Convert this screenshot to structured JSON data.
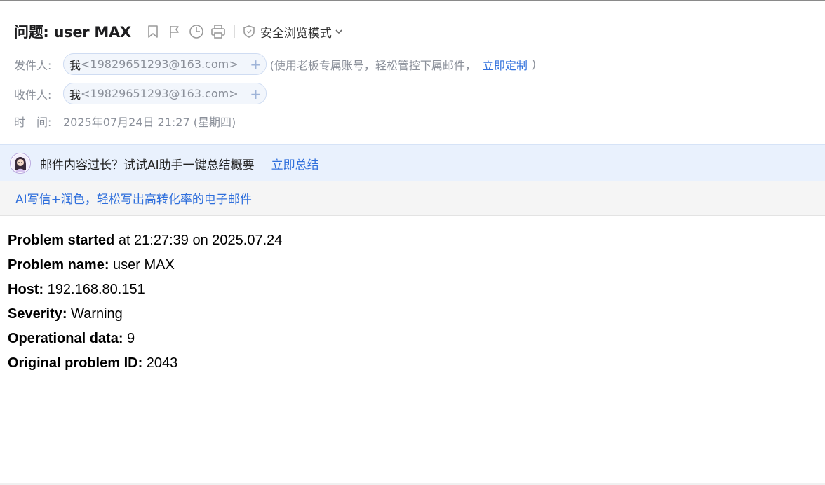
{
  "subject": {
    "prefix": "问题: ",
    "title": "user MAX"
  },
  "toolbar": {
    "icons": [
      "bookmark-icon",
      "flag-icon",
      "clock-icon",
      "print-icon"
    ],
    "safe_mode_label": "安全浏览模式"
  },
  "sender": {
    "label": "发件人:",
    "name": "我",
    "address": "<19829651293@163.com>",
    "add_label": "+",
    "promo_text": "(使用老板专属账号，轻松管控下属邮件，",
    "promo_link": "立即定制",
    "promo_close": ")"
  },
  "recipient": {
    "label": "收件人:",
    "name": "我",
    "address": "<19829651293@163.com>",
    "add_label": "+"
  },
  "time": {
    "label": "时　间:",
    "value": "2025年07月24日 21:27 (星期四)"
  },
  "ai_bar": {
    "text": "邮件内容过长？试试AI助手一键总结概要",
    "link": "立即总结"
  },
  "writer_bar": {
    "link": "AI写信+润色，轻松写出高转化率的电子邮件"
  },
  "body": [
    {
      "label": "Problem started",
      "value": " at 21:27:39 on 2025.07.24"
    },
    {
      "label": "Problem name:",
      "value": " user MAX"
    },
    {
      "label": "Host:",
      "value": " 192.168.80.151"
    },
    {
      "label": "Severity:",
      "value": " Warning"
    },
    {
      "label": "Operational data:",
      "value": " 9"
    },
    {
      "label": "Original problem ID:",
      "value": " 2043"
    }
  ],
  "colors": {
    "link": "#2f6fdc",
    "ai_bar_bg": "#e9f1fd",
    "muted": "#8a8f99"
  }
}
